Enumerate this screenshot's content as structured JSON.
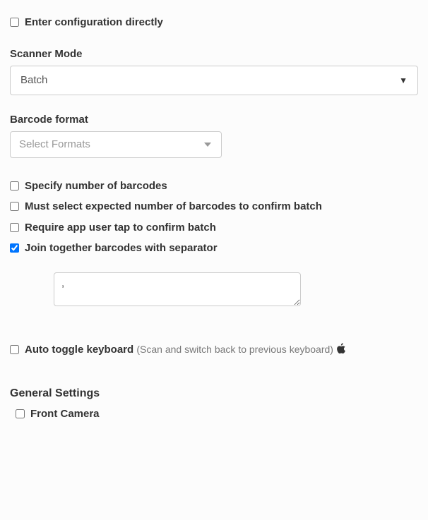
{
  "enterConfig": {
    "label": "Enter configuration directly",
    "checked": false
  },
  "scannerMode": {
    "label": "Scanner Mode",
    "value": "Batch"
  },
  "barcodeFormat": {
    "label": "Barcode format",
    "placeholder": "Select Formats"
  },
  "options": {
    "specifyNumber": {
      "label": "Specify number of barcodes",
      "checked": false
    },
    "mustSelect": {
      "label": "Must select expected number of barcodes to confirm batch",
      "checked": false
    },
    "requireTap": {
      "label": "Require app user tap to confirm batch",
      "checked": false
    },
    "joinSeparator": {
      "label": "Join together barcodes with separator",
      "checked": true,
      "value": ","
    }
  },
  "autoToggle": {
    "label": "Auto toggle keyboard",
    "hint": "(Scan and switch back to previous keyboard)",
    "checked": false
  },
  "general": {
    "heading": "General Settings",
    "frontCamera": {
      "label": "Front Camera",
      "checked": false
    }
  }
}
